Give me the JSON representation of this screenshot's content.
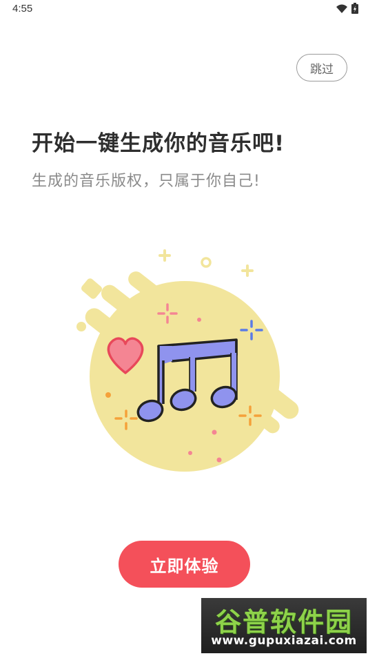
{
  "status_bar": {
    "time": "4:55",
    "icons": [
      "wifi-icon",
      "battery-icon"
    ]
  },
  "onboarding": {
    "skip_label": "跳过",
    "title": "开始一键生成你的音乐吧!",
    "subtitle": "生成的音乐版权，只属于你自己!",
    "start_label": "立即体验",
    "illustration": "music-notes-illustration"
  },
  "watermark": {
    "logo_text": "谷普软件园",
    "url_text": "www.gupuxiazai.com"
  },
  "colors": {
    "accent": "#f4505a",
    "illustration_circle": "#f2e59c",
    "notes": "#8f93ee",
    "heart": "#f48593",
    "watermark_green": "#8ed24a"
  }
}
